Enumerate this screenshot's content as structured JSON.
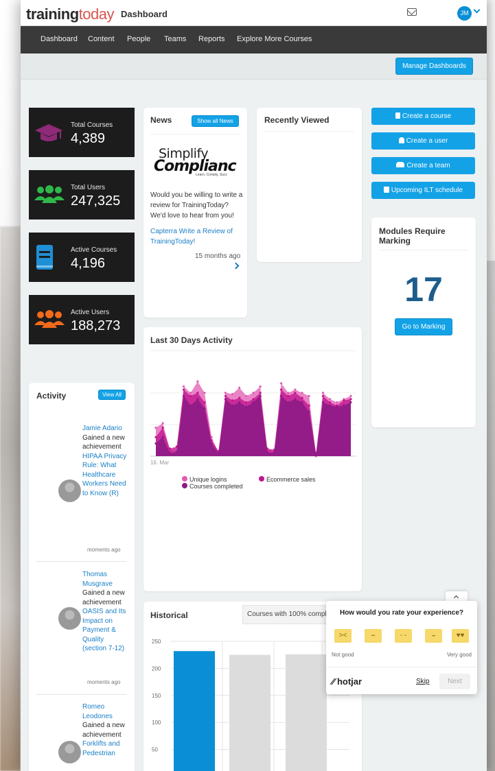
{
  "app": {
    "logo_part1": "training",
    "logo_part2": "today",
    "page_title": "Dashboard",
    "user_initials": "JM"
  },
  "nav": {
    "items": [
      "Dashboard",
      "Content",
      "People",
      "Teams",
      "Reports",
      "Explore More Courses"
    ]
  },
  "toolbar": {
    "manage_dashboards": "Manage Dashboards"
  },
  "stats": [
    {
      "label": "Total Courses",
      "value": "4,389",
      "icon": "graduation-cap-icon",
      "color": "#8e2a78"
    },
    {
      "label": "Total Users",
      "value": "247,325",
      "icon": "users-icon",
      "color": "#2fb84a"
    },
    {
      "label": "Active Courses",
      "value": "4,196",
      "icon": "book-icon",
      "color": "#1f8fd6"
    },
    {
      "label": "Active Users",
      "value": "188,273",
      "icon": "users-icon",
      "color": "#f26a1b"
    }
  ],
  "news": {
    "title": "News",
    "show_all": "Show all News",
    "brand_line1": "Simplify",
    "brand_line2": "Complianc",
    "brand_tagline": "Learn, Comply, Succ",
    "body": "Would you be willing to write a review for TrainingToday? We'd love to hear from you!",
    "link": "Capterra Write a Review of TrainingToday!",
    "time": "15 months ago"
  },
  "recent": {
    "title": "Recently Viewed"
  },
  "actions": {
    "create_course": "Create a course",
    "create_user": "Create a user",
    "create_team": "Create a team",
    "upcoming_ilt": "Upcoming ILT schedule"
  },
  "marking": {
    "title": "Modules Require Marking",
    "count": "17",
    "button": "Go to Marking"
  },
  "activity_chart": {
    "title": "Last 30 Days Activity",
    "x_label": "16. Mar",
    "legend": [
      "Unique logins",
      "Ecommerce sales",
      "Courses completed"
    ],
    "colors": {
      "unique_logins": "#e25bb3",
      "ecommerce": "#c2168f",
      "courses_completed": "#8d1b86"
    }
  },
  "chart_data": [
    {
      "type": "area",
      "title": "Last 30 Days Activity",
      "x": [
        "16. Mar",
        "",
        "",
        "",
        "",
        "",
        "",
        "",
        "",
        "",
        "",
        "",
        "",
        "",
        "",
        "",
        "",
        "",
        "",
        "",
        "",
        "",
        "",
        "",
        "",
        "",
        "",
        "",
        "",
        "",
        "",
        "",
        "",
        "",
        "",
        "",
        "",
        "",
        ""
      ],
      "series": [
        {
          "name": "Unique logins",
          "values": [
            45,
            52,
            10,
            8,
            110,
            100,
            118,
            100,
            30,
            5,
            100,
            98,
            108,
            95,
            100,
            110,
            10,
            8,
            115,
            100,
            105,
            100,
            95,
            0,
            100,
            90,
            85,
            90,
            95
          ]
        },
        {
          "name": "Ecommerce sales",
          "values": [
            30,
            45,
            12,
            15,
            105,
            95,
            100,
            85,
            25,
            8,
            95,
            88,
            92,
            85,
            90,
            100,
            12,
            10,
            105,
            95,
            100,
            92,
            80,
            5,
            95,
            85,
            80,
            88,
            90
          ]
        },
        {
          "name": "Courses completed",
          "values": [
            20,
            30,
            5,
            6,
            95,
            80,
            90,
            75,
            20,
            4,
            90,
            80,
            85,
            78,
            85,
            95,
            6,
            5,
            95,
            85,
            90,
            85,
            70,
            2,
            85,
            80,
            78,
            80,
            85
          ]
        }
      ]
    },
    {
      "type": "bar",
      "title": "Historical",
      "categories": [
        "",
        "",
        ""
      ],
      "values": [
        232,
        225,
        226
      ],
      "ylim": [
        0,
        250
      ],
      "yticks": [
        50,
        100,
        150,
        200,
        250
      ]
    }
  ],
  "historical": {
    "title": "Historical",
    "filter": "Courses with 100% compl"
  },
  "activity": {
    "title": "Activity",
    "view_all": "View All",
    "entries": [
      {
        "name": "Jamie Adario",
        "action": "Gained a new achievement",
        "course": "HIPAA Privacy Rule: What Healthcare Workers Need to Know (R)",
        "time": "moments ago"
      },
      {
        "name": "Thomas Musgrave",
        "action": "Gained a new achievement",
        "course": "OASIS and Its Impact on Payment & Quality (section 7-12)",
        "time": "moments ago"
      },
      {
        "name": "Romeo Leodones",
        "action": "Gained a new achievement",
        "course": "Forklifts and Pedestrian",
        "time": ""
      }
    ]
  },
  "hotjar": {
    "question": "How would you rate your experience?",
    "low": "Not good",
    "high": "Very good",
    "brand": "hotjar",
    "skip": "Skip",
    "next": "Next"
  }
}
